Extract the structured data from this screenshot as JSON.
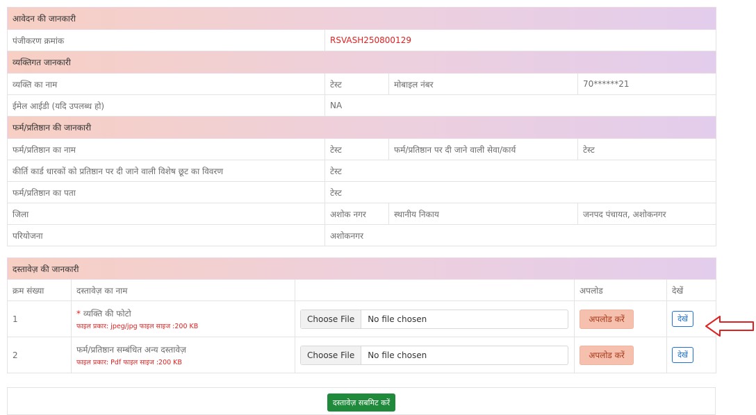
{
  "application": {
    "section_title": "आवेदन की जानकारी",
    "reg_label": "पंजीकरण क्रमांक",
    "reg_value": "RSVASH250800129"
  },
  "personal": {
    "section_title": "व्यक्तिगत जानकारी",
    "name_label": "व्यक्ति का नाम",
    "name_value": "टेस्ट",
    "mobile_label": "मोबाइल नंबर",
    "mobile_value": "70******21",
    "email_label": "ईमेल आईडी (यदि उपलब्ध हो)",
    "email_value": "NA"
  },
  "firm": {
    "section_title": "फर्म/प्रतिष्ठान की जानकारी",
    "firm_name_label": "फर्म/प्रतिष्ठान का नाम",
    "firm_name_value": "टेस्ट",
    "service_label": "फर्म/प्रतिष्ठान पर दी जाने वाली सेवा/कार्य",
    "service_value": "टेस्ट",
    "discount_label": "कीर्ति कार्ड धारकों को प्रतिष्ठान पर दी जाने वाली विशेष छूट का विवरण",
    "discount_value": "टेस्ट",
    "address_label": "फर्म/प्रतिष्ठान का पता",
    "address_value": "टेस्ट",
    "district_label": "जिला",
    "district_value": "अशोक नगर",
    "local_body_label": "स्थानीय निकाय",
    "local_body_value": "जनपद पंचायत, अशोकनगर",
    "project_label": "परियोजना",
    "project_value": "अशोकनगर"
  },
  "documents": {
    "section_title": "दस्तावेज़ की जानकारी",
    "headers": {
      "serial": "क्रम संख्या",
      "doc_name": "दस्तावेज़ का नाम",
      "file": "",
      "upload": "अपलोड",
      "view": "देखें"
    },
    "rows": [
      {
        "serial": "1",
        "required_mark": "*",
        "name": "व्यक्ति की फोटो",
        "hint": "फाइल प्रकार: jpeg/jpg फाइल साइज :200 KB",
        "choose_label": "Choose File",
        "no_file_label": "No file chosen",
        "upload_label": "अपलोड करें",
        "view_label": "देखें"
      },
      {
        "serial": "2",
        "required_mark": "",
        "name": "फर्म/प्रतिष्ठान सम्बंधित अन्य दस्तावेज़",
        "hint": "फाइल प्रकार: Pdf फाइल साइज :200 KB",
        "choose_label": "Choose File",
        "no_file_label": "No file chosen",
        "upload_label": "अपलोड करें",
        "view_label": "देखें"
      }
    ],
    "submit_label": "दस्तावेज़ सबमिट करें"
  },
  "annotation": {
    "arrow_color": "#e02020"
  }
}
